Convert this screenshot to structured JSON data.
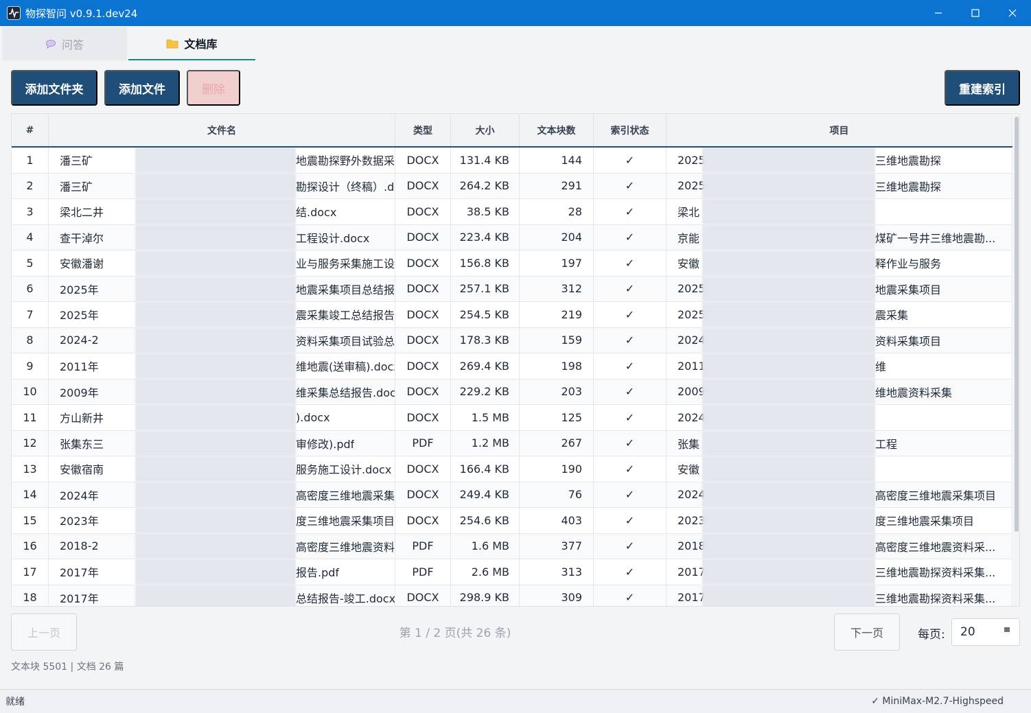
{
  "window": {
    "title": "物探智问 v0.9.1.dev24"
  },
  "tabs": [
    {
      "label": "问答",
      "icon": "speech-bubble-icon"
    },
    {
      "label": "文档库",
      "icon": "folder-icon"
    }
  ],
  "toolbar": {
    "add_folder": "添加文件夹",
    "add_file": "添加文件",
    "delete": "删除",
    "reindex": "重建索引"
  },
  "table": {
    "columns": [
      "#",
      "文件名",
      "类型",
      "大小",
      "文本块数",
      "索引状态",
      "项目"
    ],
    "rows": [
      {
        "idx": "1",
        "name_start": "潘三矿",
        "name_end": "地震勘探野外数据采集...",
        "type": "DOCX",
        "size": "131.4 KB",
        "chunks": "144",
        "status": "✓",
        "proj_start": "2025",
        "proj_end": "三维地震勘探"
      },
      {
        "idx": "2",
        "name_start": "潘三矿",
        "name_end": "勘探设计（终稿）.docx",
        "type": "DOCX",
        "size": "264.2 KB",
        "chunks": "291",
        "status": "✓",
        "proj_start": "2025",
        "proj_end": "三维地震勘探"
      },
      {
        "idx": "3",
        "name_start": "梁北二井",
        "name_end": "结.docx",
        "type": "DOCX",
        "size": "38.5 KB",
        "chunks": "28",
        "status": "✓",
        "proj_start": "梁北",
        "proj_end": ""
      },
      {
        "idx": "4",
        "name_start": "查干淖尔",
        "name_end": "工程设计.docx",
        "type": "DOCX",
        "size": "223.4 KB",
        "chunks": "204",
        "status": "✓",
        "proj_start": "京能",
        "proj_end": "煤矿一号井三维地震勘..."
      },
      {
        "idx": "5",
        "name_start": "安徽潘谢",
        "name_end": "业与服务采集施工设计...",
        "type": "DOCX",
        "size": "156.8 KB",
        "chunks": "197",
        "status": "✓",
        "proj_start": "安徽",
        "proj_end": "释作业与服务"
      },
      {
        "idx": "6",
        "name_start": "2025年",
        "name_end": "地震采集项目总结报告...",
        "type": "DOCX",
        "size": "257.1 KB",
        "chunks": "312",
        "status": "✓",
        "proj_start": "2025",
        "proj_end": "地震采集项目"
      },
      {
        "idx": "7",
        "name_start": "2025年",
        "name_end": "震采集竣工总结报告.docx",
        "type": "DOCX",
        "size": "254.5 KB",
        "chunks": "219",
        "status": "✓",
        "proj_start": "2025",
        "proj_end": "震采集"
      },
      {
        "idx": "8",
        "name_start": "2024-2",
        "name_end": "资料采集项目试验总结报...",
        "type": "DOCX",
        "size": "178.3 KB",
        "chunks": "159",
        "status": "✓",
        "proj_start": "2024",
        "proj_end": "资料采集项目"
      },
      {
        "idx": "9",
        "name_start": "2011年",
        "name_end": "维地震(送审稿).docx",
        "type": "DOCX",
        "size": "269.4 KB",
        "chunks": "198",
        "status": "✓",
        "proj_start": "2011",
        "proj_end": "维"
      },
      {
        "idx": "10",
        "name_start": "2009年",
        "name_end": "维采集总结报告.docx",
        "type": "DOCX",
        "size": "229.2 KB",
        "chunks": "203",
        "status": "✓",
        "proj_start": "2009",
        "proj_end": "维地震资料采集"
      },
      {
        "idx": "11",
        "name_start": "方山新井",
        "name_end": ").docx",
        "type": "DOCX",
        "size": "1.5 MB",
        "chunks": "125",
        "status": "✓",
        "proj_start": "2024",
        "proj_end": ""
      },
      {
        "idx": "12",
        "name_start": "张集东三",
        "name_end": "审修改).pdf",
        "type": "PDF",
        "size": "1.2 MB",
        "chunks": "267",
        "status": "✓",
        "proj_start": "张集",
        "proj_end": "工程"
      },
      {
        "idx": "13",
        "name_start": "安徽宿南",
        "name_end": "服务施工设计.docx",
        "type": "DOCX",
        "size": "166.4 KB",
        "chunks": "190",
        "status": "✓",
        "proj_start": "安徽",
        "proj_end": ""
      },
      {
        "idx": "14",
        "name_start": "2024年",
        "name_end": "高密度三维地震采集项...",
        "type": "DOCX",
        "size": "249.4 KB",
        "chunks": "76",
        "status": "✓",
        "proj_start": "2024",
        "proj_end": "高密度三维地震采集项目"
      },
      {
        "idx": "15",
        "name_start": "2023年",
        "name_end": "度三维地震采集项目总...",
        "type": "DOCX",
        "size": "254.6 KB",
        "chunks": "403",
        "status": "✓",
        "proj_start": "2023",
        "proj_end": "度三维地震采集项目"
      },
      {
        "idx": "16",
        "name_start": "2018-2",
        "name_end": "高密度三维地震资料采集...",
        "type": "PDF",
        "size": "1.6 MB",
        "chunks": "377",
        "status": "✓",
        "proj_start": "2018",
        "proj_end": "高密度三维地震资料采..."
      },
      {
        "idx": "17",
        "name_start": "2017年",
        "name_end": "报告.pdf",
        "type": "PDF",
        "size": "2.6 MB",
        "chunks": "313",
        "status": "✓",
        "proj_start": "2017",
        "proj_end": "三维地震勘探资料采集..."
      },
      {
        "idx": "18",
        "name_start": "2017年",
        "name_end": "总结报告-竣工.docx",
        "type": "DOCX",
        "size": "298.9 KB",
        "chunks": "309",
        "status": "✓",
        "proj_start": "2017",
        "proj_end": "三维地震勘探资料采集..."
      }
    ]
  },
  "pagination": {
    "prev": "上一页",
    "next": "下一页",
    "info": "第 1 / 2 页(共 26 条)",
    "per_page_label": "每页:",
    "per_page_value": "20"
  },
  "stats": "文本块 5501 | 文档 26 篇",
  "statusbar": {
    "left": "就绪",
    "right": "✓ MiniMax-M2.7-Highspeed"
  }
}
